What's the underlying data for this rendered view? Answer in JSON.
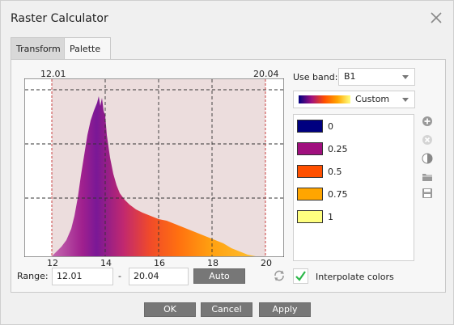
{
  "window": {
    "title": "Raster Calculator"
  },
  "tabs": [
    {
      "label": "Transform"
    },
    {
      "label": "Palette"
    }
  ],
  "histogram": {
    "min_label": "12.01",
    "max_label": "20.04",
    "x_ticks": [
      "12",
      "14",
      "16",
      "18",
      "20"
    ]
  },
  "range": {
    "label": "Range:",
    "from": "12.01",
    "separator": "-",
    "to": "20.04",
    "auto_label": "Auto"
  },
  "band": {
    "label": "Use band:",
    "value": "B1"
  },
  "palette": {
    "preset": "Custom",
    "entries": [
      {
        "value": "0",
        "color": "#000080"
      },
      {
        "value": "0.25",
        "color": "#a0107e"
      },
      {
        "value": "0.5",
        "color": "#ff5000"
      },
      {
        "value": "0.75",
        "color": "#ffa500"
      },
      {
        "value": "1",
        "color": "#ffff80"
      }
    ]
  },
  "interpolate": {
    "label": "Interpolate colors",
    "checked": true
  },
  "buttons": {
    "ok": "OK",
    "cancel": "Cancel",
    "apply": "Apply"
  }
}
